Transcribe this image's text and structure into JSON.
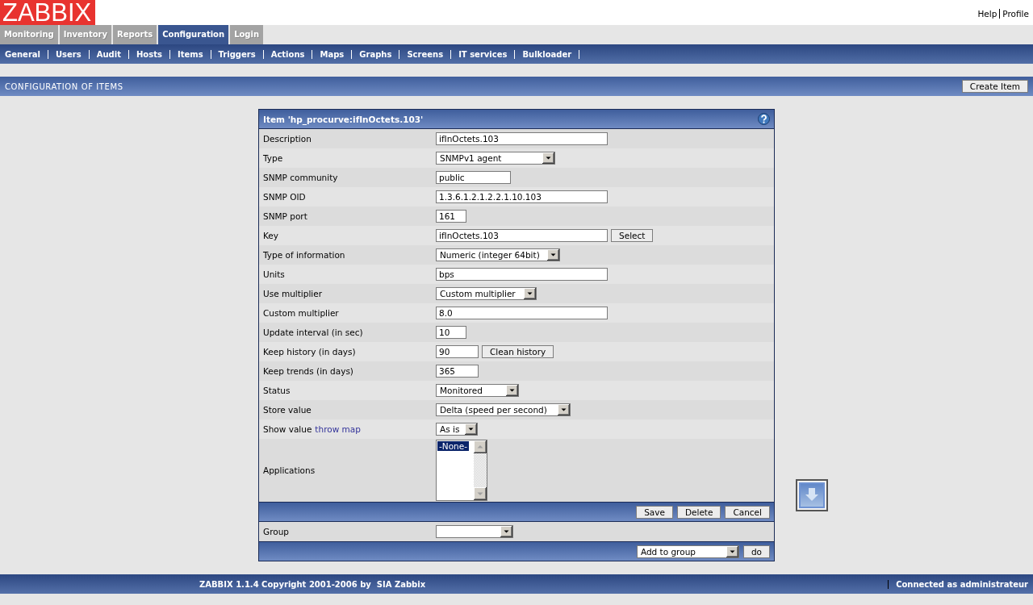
{
  "header": {
    "logo": "ZABBIX",
    "links": [
      "Help",
      "Profile"
    ]
  },
  "tabs": [
    {
      "label": "Monitoring",
      "selected": false
    },
    {
      "label": "Inventory",
      "selected": false
    },
    {
      "label": "Reports",
      "selected": false
    },
    {
      "label": "Configuration",
      "selected": true
    },
    {
      "label": "Login",
      "selected": false
    }
  ],
  "menu": [
    "General",
    "Users",
    "Audit",
    "Hosts",
    "Items",
    "Triggers",
    "Actions",
    "Maps",
    "Graphs",
    "Screens",
    "IT services",
    "Bulkloader"
  ],
  "page_title": {
    "title": "CONFIGURATION OF ITEMS",
    "button": "Create Item"
  },
  "form": {
    "title": "Item 'hp_procurve:ifInOctets.103'",
    "rows": [
      {
        "kind": "text",
        "label": "Description",
        "value": "ifInOctets.103"
      },
      {
        "kind": "select",
        "label": "Type",
        "value": "SNMPv1 agent"
      },
      {
        "kind": "text",
        "label": "SNMP community",
        "value": "public"
      },
      {
        "kind": "text",
        "label": "SNMP OID",
        "value": "1.3.6.1.2.1.2.2.1.10.103"
      },
      {
        "kind": "text",
        "label": "SNMP port",
        "value": "161"
      },
      {
        "kind": "text",
        "label": "Key",
        "value": "ifInOctets.103",
        "button": "Select"
      },
      {
        "kind": "select",
        "label": "Type of information",
        "value": "Numeric (integer 64bit)"
      },
      {
        "kind": "text",
        "label": "Units",
        "value": "bps"
      },
      {
        "kind": "select",
        "label": "Use multiplier",
        "value": "Custom multiplier"
      },
      {
        "kind": "text",
        "label": "Custom multiplier",
        "value": "8.0"
      },
      {
        "kind": "text",
        "label": "Update interval (in sec)",
        "value": "10"
      },
      {
        "kind": "text",
        "label": "Keep history (in days)",
        "value": "90",
        "button": "Clean history"
      },
      {
        "kind": "text",
        "label": "Keep trends (in days)",
        "value": "365"
      },
      {
        "kind": "select",
        "label": "Status",
        "value": "Monitored"
      },
      {
        "kind": "select",
        "label": "Store value",
        "value": "Delta (speed per second)"
      },
      {
        "kind": "select",
        "label": "Show value",
        "link": "throw map",
        "value": "As is"
      },
      {
        "kind": "listbox",
        "label": "Applications",
        "options": [
          {
            "label": "-None-",
            "selected": true
          }
        ]
      }
    ],
    "actions": [
      "Save",
      "Delete",
      "Cancel"
    ],
    "group": {
      "label": "Group"
    },
    "mass_action": {
      "value": "Add to group",
      "button": "do"
    }
  },
  "footer": {
    "copyright": "ZABBIX 1.1.4 Copyright 2001-2006 by  SIA Zabbix",
    "status": "Connected as administrateur"
  }
}
